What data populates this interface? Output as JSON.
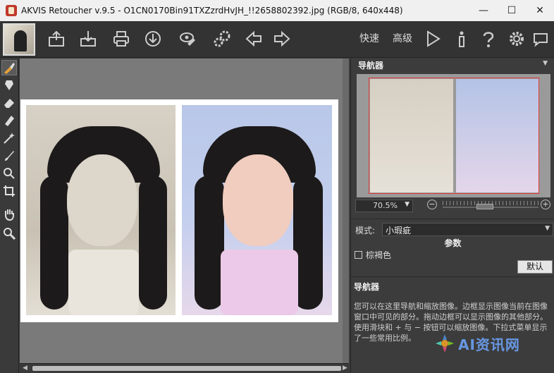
{
  "window": {
    "title": "AKVIS Retoucher v.9.5 - O1CN0170Bin91TXZzrdHvJH_!!2658802392.jpg (RGB/8, 640x448)",
    "minimize_glyph": "—",
    "maximize_glyph": "☐",
    "close_glyph": "✕"
  },
  "toolbar": {
    "mode_express": "快速",
    "mode_advanced": "高级",
    "icons": [
      "open-icon",
      "save-icon",
      "print-icon",
      "publish-icon",
      "batch-icon",
      "plugins-icon",
      "back-icon",
      "forward-icon",
      "run-icon",
      "info-icon",
      "help-icon",
      "settings-icon",
      "comments-icon"
    ]
  },
  "tools": [
    "retouch-brush-icon",
    "stamp-icon",
    "eraser-icon",
    "patch-icon",
    "magic-wand-icon",
    "brush-icon",
    "clone-icon",
    "crop-icon",
    "hand-icon",
    "zoom-icon"
  ],
  "navigator": {
    "title": "导航器",
    "zoom_value": "70.5%",
    "zoom_minus": "−",
    "zoom_plus": "+"
  },
  "settings": {
    "mode_label": "模式:",
    "mode_value": "小瑕疵",
    "params_title": "参数",
    "sepia_label": "棕褐色",
    "sepia_checked": false,
    "default_button": "默认"
  },
  "help": {
    "title": "导航器",
    "text": "您可以在这里导航和缩放图像。边框显示图像当前在图像窗口中可见的部分。拖动边框可以显示图像的其他部分。使用滑块和 + 与 − 按钮可以缩放图像。下拉式菜单显示了一些常用比例。"
  },
  "watermark": {
    "text": "AI资讯网"
  }
}
